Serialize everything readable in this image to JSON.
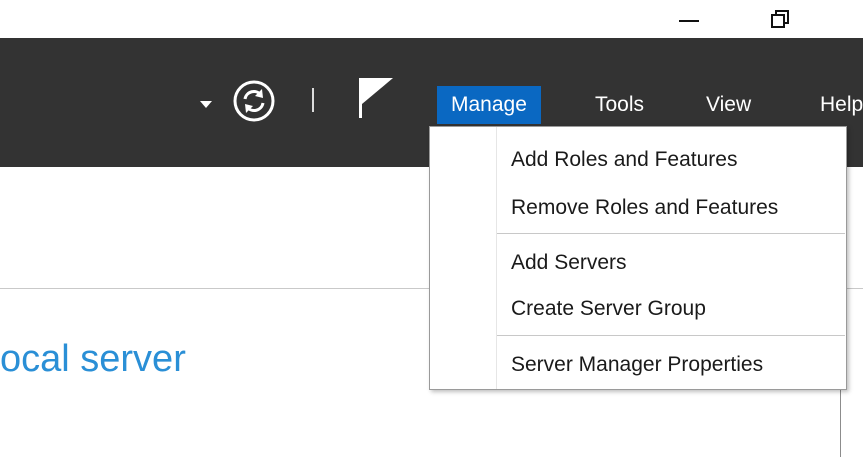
{
  "window": {
    "minimize_icon": "minimize-icon",
    "restore_icon": "restore-icon"
  },
  "toolbar": {
    "dropdown_icon": "caret-down-icon",
    "refresh_icon": "refresh-icon",
    "flag_icon": "flag-icon",
    "menus": [
      {
        "label": "Manage",
        "active": true
      },
      {
        "label": "Tools"
      },
      {
        "label": "View"
      },
      {
        "label": "Help"
      }
    ]
  },
  "dropdown": {
    "items": [
      {
        "label": "Add Roles and Features"
      },
      {
        "label": "Remove Roles and Features"
      },
      {
        "label": "Add Servers"
      },
      {
        "label": "Create Server Group"
      },
      {
        "label": "Server Manager Properties"
      }
    ]
  },
  "main": {
    "heading": "ocal server"
  },
  "colors": {
    "toolbar": "#333333",
    "active_menu": "#0a68c2",
    "heading": "#2a8fd6"
  }
}
